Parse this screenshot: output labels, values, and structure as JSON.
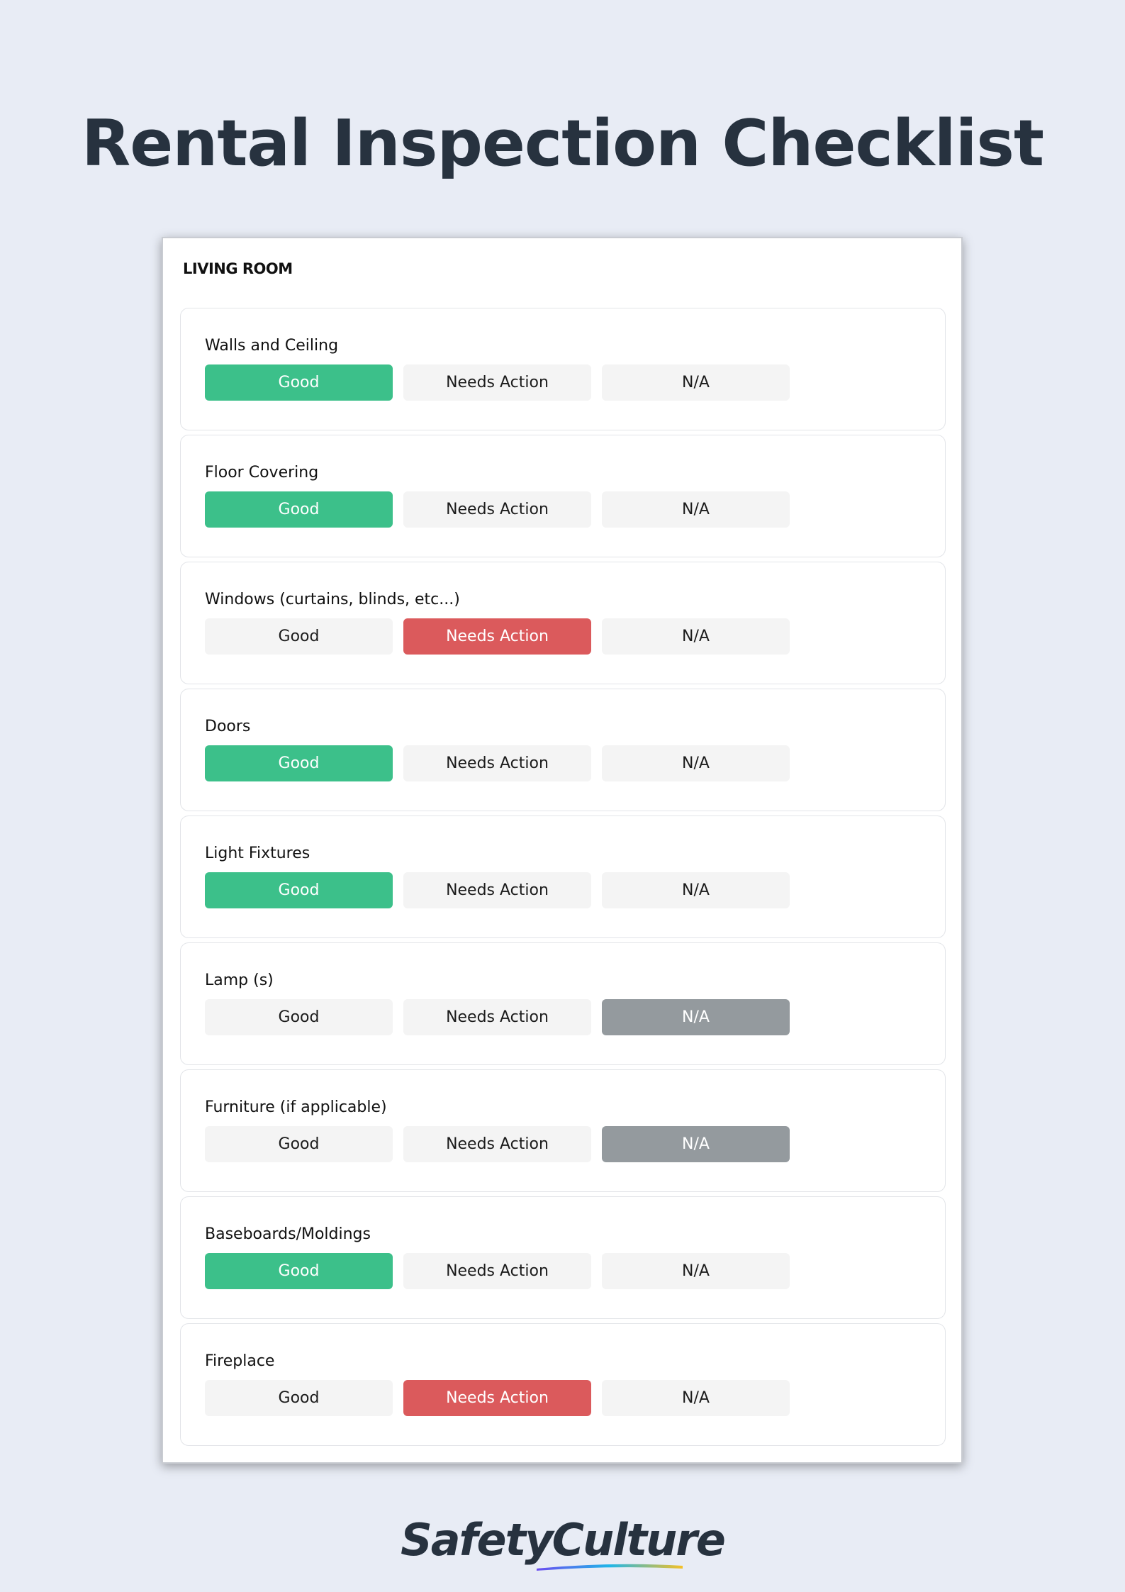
{
  "title": "Rental Inspection Checklist",
  "section": {
    "title": "LIVING ROOM"
  },
  "options": [
    "Good",
    "Needs Action",
    "N/A"
  ],
  "items": [
    {
      "label": "Walls and Ceiling",
      "selected": "Good"
    },
    {
      "label": "Floor Covering",
      "selected": "Good"
    },
    {
      "label": "Windows (curtains, blinds, etc...)",
      "selected": "Needs Action"
    },
    {
      "label": "Doors",
      "selected": "Good"
    },
    {
      "label": "Light Fixtures",
      "selected": "Good"
    },
    {
      "label": "Lamp (s)",
      "selected": "N/A"
    },
    {
      "label": "Furniture (if applicable)",
      "selected": "N/A"
    },
    {
      "label": "Baseboards/Moldings",
      "selected": "Good"
    },
    {
      "label": "Fireplace",
      "selected": "Needs Action"
    }
  ],
  "colors": {
    "good": "#3cc08a",
    "needs_action": "#db5a5c",
    "na": "#949a9e",
    "unselected": "#f4f4f4",
    "background": "#e8ecf5",
    "title": "#27323f"
  },
  "footer": {
    "logo_text": "SafetyCulture"
  }
}
